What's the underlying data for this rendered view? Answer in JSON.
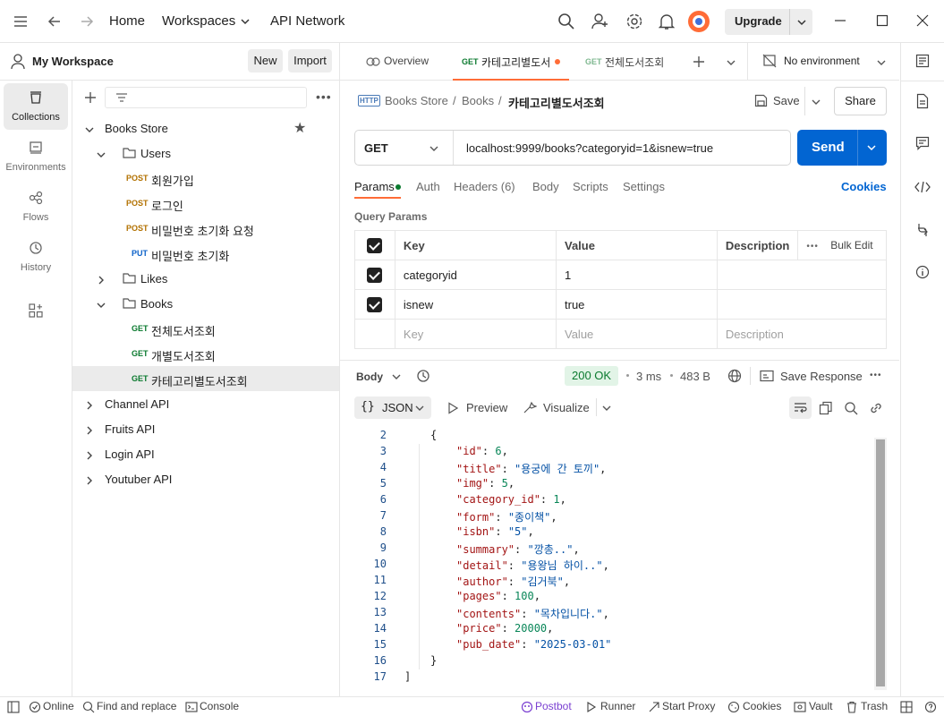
{
  "topbar": {
    "home": "Home",
    "workspaces": "Workspaces",
    "api_network": "API Network",
    "upgrade": "Upgrade"
  },
  "workspace": {
    "name": "My Workspace",
    "new_label": "New",
    "import_label": "Import"
  },
  "leftnav": [
    {
      "label": "Collections",
      "icon": "collections-icon"
    },
    {
      "label": "Environments",
      "icon": "environments-icon"
    },
    {
      "label": "Flows",
      "icon": "flows-icon"
    },
    {
      "label": "History",
      "icon": "history-icon"
    }
  ],
  "tree": {
    "root": "Books Store",
    "users_folder": "Users",
    "users_items": [
      {
        "method": "POST",
        "label": "회원가입"
      },
      {
        "method": "POST",
        "label": "로그인"
      },
      {
        "method": "POST",
        "label": "비밀번호 초기화 요청"
      },
      {
        "method": "PUT",
        "label": "비밀번호 초기화"
      }
    ],
    "likes_folder": "Likes",
    "books_folder": "Books",
    "books_items": [
      {
        "method": "GET",
        "label": "전체도서조회"
      },
      {
        "method": "GET",
        "label": "개별도서조회"
      },
      {
        "method": "GET",
        "label": "카테고리별도서조회"
      }
    ],
    "collections": [
      "Channel API",
      "Fruits API",
      "Login API",
      "Youtuber API"
    ]
  },
  "tabs": {
    "overview": "Overview",
    "active_method": "GET",
    "active_label": "카테고리별도서",
    "second_method": "GET",
    "second_label": "전체도서조회",
    "environment": "No environment"
  },
  "request": {
    "breadcrumb": [
      "Books Store",
      "Books"
    ],
    "name": "카테고리별도서조회",
    "save": "Save",
    "share": "Share",
    "method": "GET",
    "url": "localhost:9999/books?categoryid=1&isnew=true",
    "send": "Send",
    "subtabs": {
      "params": "Params",
      "auth": "Auth",
      "headers": "Headers (6)",
      "body": "Body",
      "scripts": "Scripts",
      "settings": "Settings",
      "cookies": "Cookies"
    },
    "query_params_title": "Query Params",
    "columns": {
      "key": "Key",
      "value": "Value",
      "description": "Description",
      "bulk_edit": "Bulk Edit"
    },
    "params": [
      {
        "key": "categoryid",
        "value": "1"
      },
      {
        "key": "isnew",
        "value": "true"
      }
    ],
    "placeholders": {
      "key": "Key",
      "value": "Value",
      "description": "Description"
    }
  },
  "response": {
    "body_label": "Body",
    "status": "200 OK",
    "time": "3 ms",
    "size": "483 B",
    "save_response": "Save Response",
    "format": "JSON",
    "preview": "Preview",
    "visualize": "Visualize",
    "lines": [
      {
        "n": "2",
        "indent": 1,
        "text": "{"
      },
      {
        "n": "3",
        "indent": 2,
        "key": "id",
        "num": "6"
      },
      {
        "n": "4",
        "indent": 2,
        "key": "title",
        "str": "용궁에 간 토끼"
      },
      {
        "n": "5",
        "indent": 2,
        "key": "img",
        "num": "5"
      },
      {
        "n": "6",
        "indent": 2,
        "key": "category_id",
        "num": "1"
      },
      {
        "n": "7",
        "indent": 2,
        "key": "form",
        "str": "종이책"
      },
      {
        "n": "8",
        "indent": 2,
        "key": "isbn",
        "str": "5"
      },
      {
        "n": "9",
        "indent": 2,
        "key": "summary",
        "str": "깡총.."
      },
      {
        "n": "10",
        "indent": 2,
        "key": "detail",
        "str": "용왕님 하이.."
      },
      {
        "n": "11",
        "indent": 2,
        "key": "author",
        "str": "김거북"
      },
      {
        "n": "12",
        "indent": 2,
        "key": "pages",
        "num": "100"
      },
      {
        "n": "13",
        "indent": 2,
        "key": "contents",
        "str": "목차입니다."
      },
      {
        "n": "14",
        "indent": 2,
        "key": "price",
        "num": "20000"
      },
      {
        "n": "15",
        "indent": 2,
        "key": "pub_date",
        "str": "2025-03-01",
        "last": true
      },
      {
        "n": "16",
        "indent": 1,
        "text": "}"
      },
      {
        "n": "17",
        "indent": 0,
        "text": "]"
      }
    ]
  },
  "statusbar": {
    "online": "Online",
    "find_replace": "Find and replace",
    "console": "Console",
    "postbot": "Postbot",
    "runner": "Runner",
    "start_proxy": "Start Proxy",
    "cookies": "Cookies",
    "vault": "Vault",
    "trash": "Trash"
  },
  "colors": {
    "accent": "#0265d2",
    "ok_green": "#0b7a2f",
    "ok_bg": "#e2f4e7",
    "post": "#b27100",
    "get": "#0b7a2f",
    "put": "#0c62c9",
    "active_tab_dot": "#ff6c37"
  }
}
